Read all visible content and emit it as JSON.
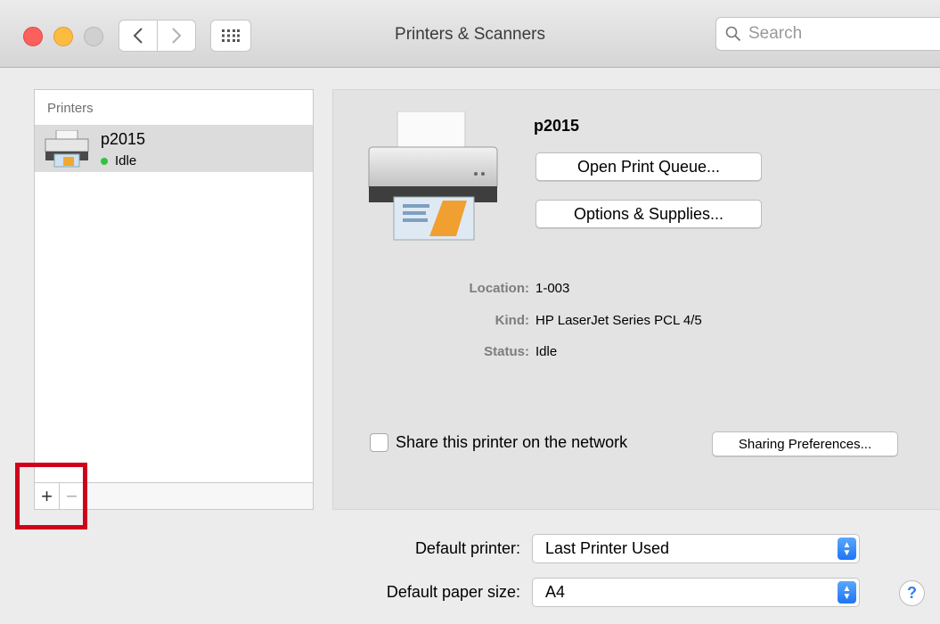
{
  "window": {
    "title": "Printers & Scanners",
    "search": {
      "placeholder": "Search"
    }
  },
  "printers": {
    "header": "Printers",
    "items": [
      {
        "name": "p2015",
        "status": "Idle",
        "status_color": "#32c241"
      }
    ],
    "add_label": "+",
    "remove_label": "−"
  },
  "detail": {
    "title": "p2015",
    "open_queue_label": "Open Print Queue...",
    "options_label": "Options & Supplies...",
    "location_label": "Location:",
    "location_value": "1-003",
    "kind_label": "Kind:",
    "kind_value": "HP LaserJet Series PCL 4/5",
    "status_label": "Status:",
    "status_value": "Idle",
    "share_label": "Share this printer on the network",
    "share_checked": false,
    "sharing_prefs_label": "Sharing Preferences..."
  },
  "defaults": {
    "printer_label": "Default printer:",
    "printer_value": "Last Printer Used",
    "paper_label": "Default paper size:",
    "paper_value": "A4"
  },
  "help_label": "?",
  "colors": {
    "highlight": "#d0021b",
    "accent": "#1e75f6"
  }
}
